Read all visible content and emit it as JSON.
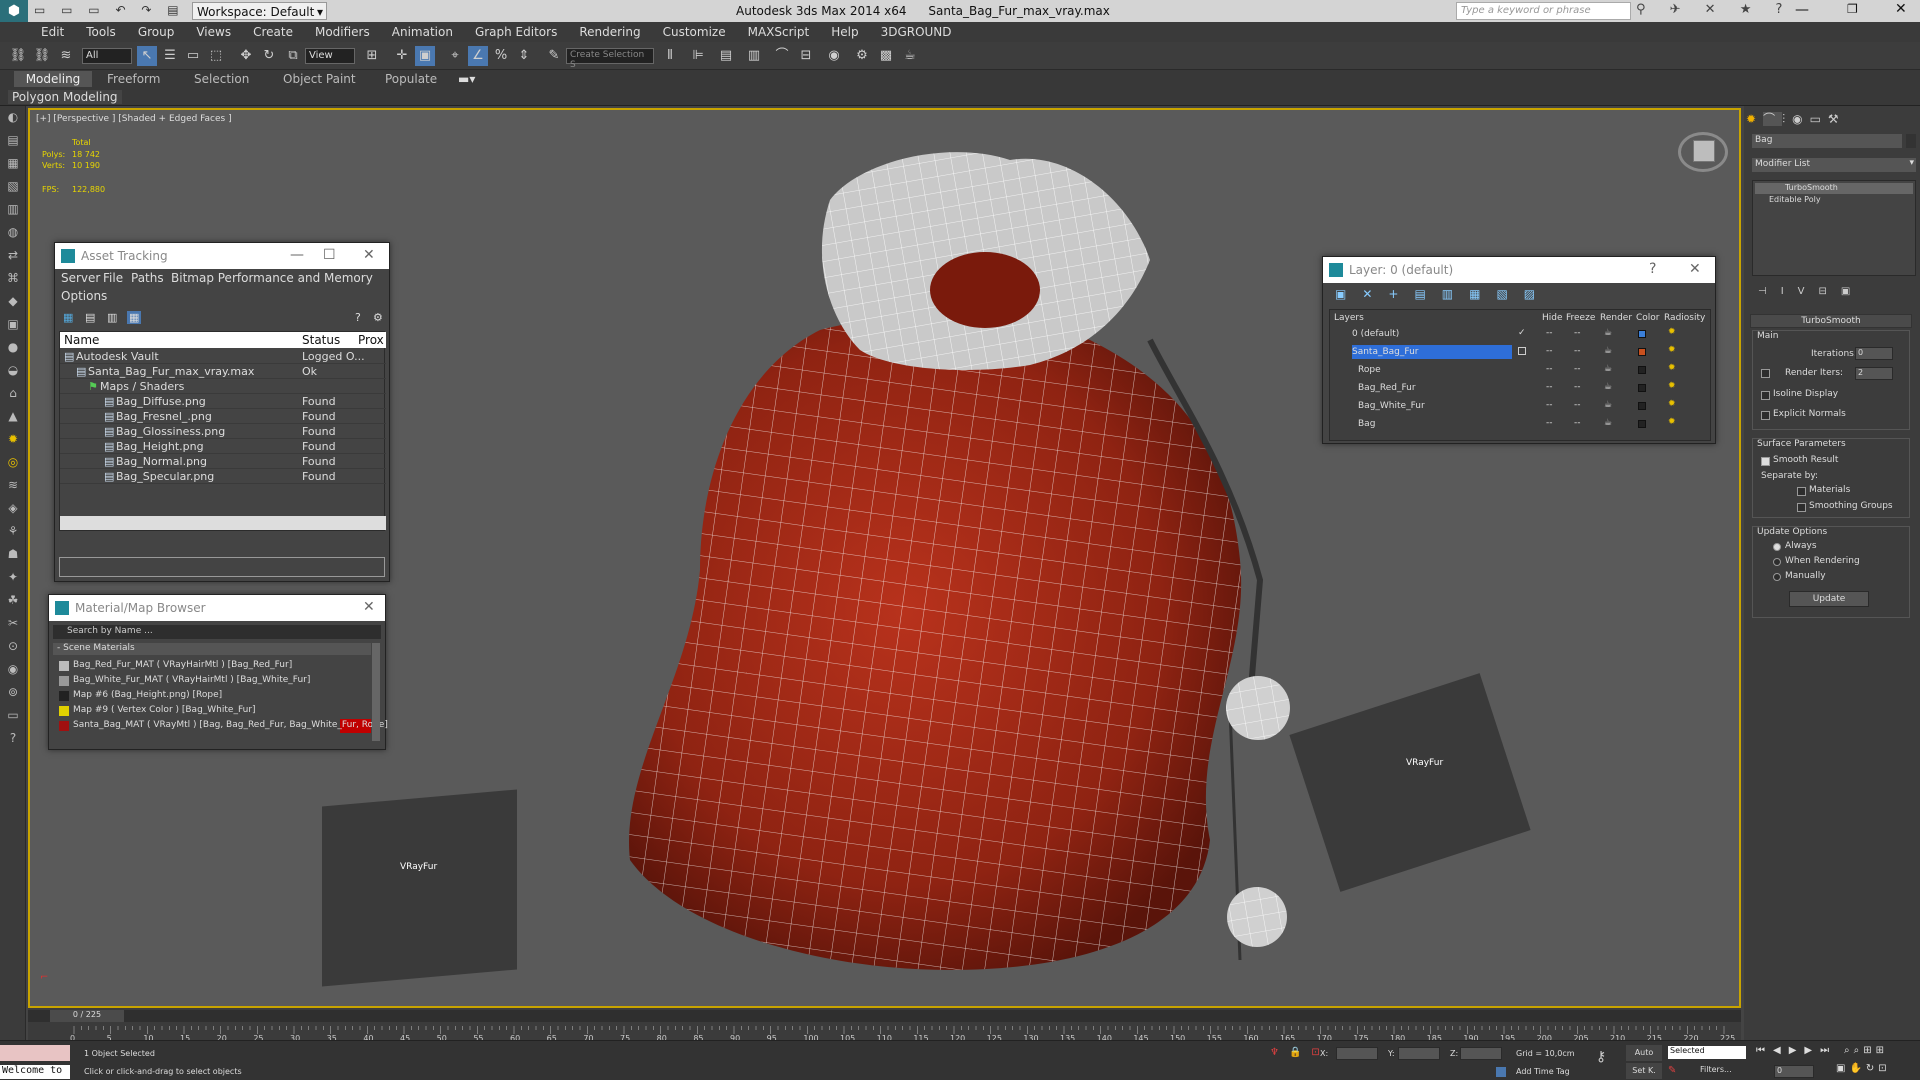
{
  "title": {
    "workspace": "Workspace: Default",
    "app": "Autodesk 3ds Max  2014 x64",
    "file": "Santa_Bag_Fur_max_vray.max",
    "search_placeholder": "Type a keyword or phrase"
  },
  "menu": [
    "Edit",
    "Tools",
    "Group",
    "Views",
    "Create",
    "Modifiers",
    "Animation",
    "Graph Editors",
    "Rendering",
    "Customize",
    "MAXScript",
    "Help",
    "3DGROUND"
  ],
  "toolbar": {
    "filter": "All",
    "view": "View",
    "selection_set": "Create Selection S"
  },
  "ribbon": {
    "tabs": [
      "Modeling",
      "Freeform",
      "Selection",
      "Object Paint",
      "Populate"
    ],
    "sub": "Polygon Modeling"
  },
  "viewport": {
    "label": "[+] [Perspective ] [Shaded + Edged Faces ]",
    "stats_total": "Total",
    "polys_label": "Polys:",
    "polys": "18 742",
    "verts_label": "Verts:",
    "verts": "10 190",
    "fps_label": "FPS:",
    "fps": "122,880",
    "vrayfur1": "VRayFur",
    "vrayfur2": "VRayFur"
  },
  "asset": {
    "title": "Asset Tracking",
    "menu": [
      "Server",
      "File",
      "Paths",
      "Bitmap Performance and Memory"
    ],
    "menu2": "Options",
    "col_name": "Name",
    "col_status": "Status",
    "col_prox": "Prox",
    "rows": [
      {
        "name": "Autodesk Vault",
        "status": "Logged O..."
      },
      {
        "name": "Santa_Bag_Fur_max_vray.max",
        "status": "Ok"
      },
      {
        "name": "Maps / Shaders",
        "status": ""
      },
      {
        "name": "Bag_Diffuse.png",
        "status": "Found"
      },
      {
        "name": "Bag_Fresnel_.png",
        "status": "Found"
      },
      {
        "name": "Bag_Glossiness.png",
        "status": "Found"
      },
      {
        "name": "Bag_Height.png",
        "status": "Found"
      },
      {
        "name": "Bag_Normal.png",
        "status": "Found"
      },
      {
        "name": "Bag_Specular.png",
        "status": "Found"
      }
    ]
  },
  "matbrowser": {
    "title": "Material/Map Browser",
    "search": "Search by Name ...",
    "section": "- Scene Materials",
    "items": [
      "Bag_Red_Fur_MAT  ( VRayHairMtl )  [Bag_Red_Fur]",
      "Bag_White_Fur_MAT  ( VRayHairMtl )  [Bag_White_Fur]",
      "Map #6 (Bag_Height.png)  [Rope]",
      "Map #9  ( Vertex Color )  [Bag_White_Fur]",
      "Santa_Bag_MAT  ( VRayMtl )  [Bag, Bag_Red_Fur, Bag_White_Fur, Rope]"
    ]
  },
  "layers": {
    "title": "Layer: 0 (default)",
    "help": "?",
    "cols": [
      "Layers",
      "Hide",
      "Freeze",
      "Render",
      "Color",
      "Radiosity"
    ],
    "rows": [
      {
        "name": "0 (default)",
        "color": "#3b7fd8"
      },
      {
        "name": "Santa_Bag_Fur",
        "color": "#c8501e"
      },
      {
        "name": "Rope",
        "color": "#222222"
      },
      {
        "name": "Bag_Red_Fur",
        "color": "#222222"
      },
      {
        "name": "Bag_White_Fur",
        "color": "#222222"
      },
      {
        "name": "Bag",
        "color": "#222222"
      }
    ]
  },
  "command": {
    "object_name": "Bag",
    "modifier_list": "Modifier List",
    "stack": [
      "TurboSmooth",
      "Editable Poly"
    ],
    "rollout": "TurboSmooth",
    "main": "Main",
    "iterations_label": "Iterations:",
    "iterations": "0",
    "render_iters_label": "Render Iters:",
    "render_iters": "2",
    "isoline": "Isoline Display",
    "explicit": "Explicit Normals",
    "surface": "Surface Parameters",
    "smooth_result": "Smooth Result",
    "separate": "Separate by:",
    "materials": "Materials",
    "smoothing": "Smoothing Groups",
    "update_options": "Update Options",
    "always": "Always",
    "when_rendering": "When Rendering",
    "manually": "Manually",
    "update": "Update"
  },
  "timeline": {
    "frame": "0 / 225",
    "ticks": [
      "0",
      "5",
      "10",
      "15",
      "20",
      "25",
      "30",
      "35",
      "40",
      "45",
      "50",
      "55",
      "60",
      "65",
      "70",
      "75",
      "80",
      "85",
      "90",
      "95",
      "100",
      "105",
      "110",
      "115",
      "120",
      "125",
      "130",
      "135",
      "140",
      "145",
      "150",
      "155",
      "160",
      "165",
      "170",
      "175",
      "180",
      "185",
      "190",
      "195",
      "200",
      "205",
      "210",
      "215",
      "220",
      "225"
    ]
  },
  "status": {
    "maxscript": "Welcome to",
    "selected": "1 Object Selected",
    "prompt": "Click or click-and-drag to select objects",
    "x": "X:",
    "y": "Y:",
    "z": "Z:",
    "grid": "Grid = 10,0cm",
    "auto": "Auto",
    "selected_dd": "Selected",
    "setk": "Set K.",
    "filters": "Filters...",
    "addtime": "Add Time Tag",
    "frame": "0"
  }
}
